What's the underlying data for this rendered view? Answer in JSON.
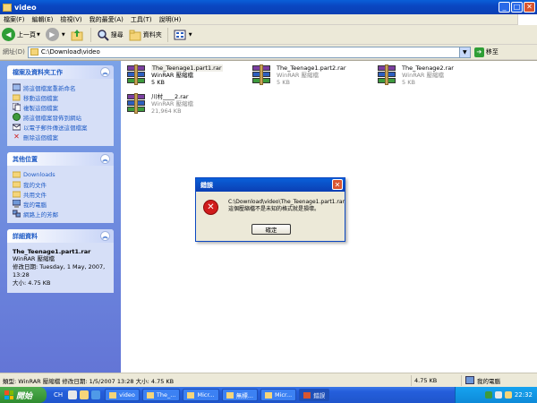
{
  "window": {
    "title": "video"
  },
  "menu": [
    "檔案(F)",
    "編輯(E)",
    "檢視(V)",
    "我的最愛(A)",
    "工具(T)",
    "說明(H)"
  ],
  "toolbar": {
    "back": "上一頁",
    "search": "搜尋",
    "folders": "資料夾"
  },
  "address": {
    "label": "網址(D)",
    "path": "C:\\Download\\video",
    "go": "移至"
  },
  "tasks_panel": {
    "title": "檔案及資料夾工作",
    "items": [
      "將這個檔案重新命名",
      "移動這個檔案",
      "複製這個檔案",
      "將這個檔案發佈到網站",
      "以電子郵件傳送這個檔案",
      "刪除這個檔案"
    ]
  },
  "places_panel": {
    "title": "其他位置",
    "items": [
      "Downloads",
      "我的文件",
      "共用文件",
      "我的電腦",
      "網路上的芳鄰"
    ]
  },
  "details_panel": {
    "title": "詳細資料",
    "name": "The_Teenage1.part1.rar",
    "type": "WinRAR 壓縮檔",
    "modified": "修改日期: Tuesday, 1 May, 2007, 13:28",
    "size": "大小: 4.75 KB"
  },
  "files": [
    {
      "name": "The_Teenage1.part1.rar",
      "type": "WinRAR 壓縮檔",
      "size": "5 KB"
    },
    {
      "name": "The_Teenage1.part2.rar",
      "type": "WinRAR 壓縮檔",
      "size": "5 KB"
    },
    {
      "name": "The_Teenage2.rar",
      "type": "WinRAR 壓縮檔",
      "size": "5 KB"
    },
    {
      "name": "川村____2.rar",
      "type": "WinRAR 壓縮檔",
      "size": "21,964 KB"
    }
  ],
  "dialog": {
    "title": "錯誤",
    "line1": "C:\\Download\\video\\The_Teenage1.part1.rar",
    "line2": "這個壓縮檔不是未知的格式就是損壞。",
    "ok": "確定"
  },
  "status": {
    "info": "類型: WinRAR 壓縮檔 修改日期: 1/5/2007 13:28 大小: 4.75 KB",
    "size": "4.75 KB",
    "location": "我的電腦"
  },
  "taskbar": {
    "start": "開始",
    "lang": "CH",
    "tasks": [
      "video",
      "The_...",
      "Micr...",
      "無標...",
      "Micr...",
      "錯誤"
    ],
    "clock": "22:32"
  },
  "colors": {
    "xp_blue": "#0a47c2",
    "panel_link": "#215dc6",
    "error_red": "#d01c1c",
    "start_green": "#2f8b2f"
  }
}
